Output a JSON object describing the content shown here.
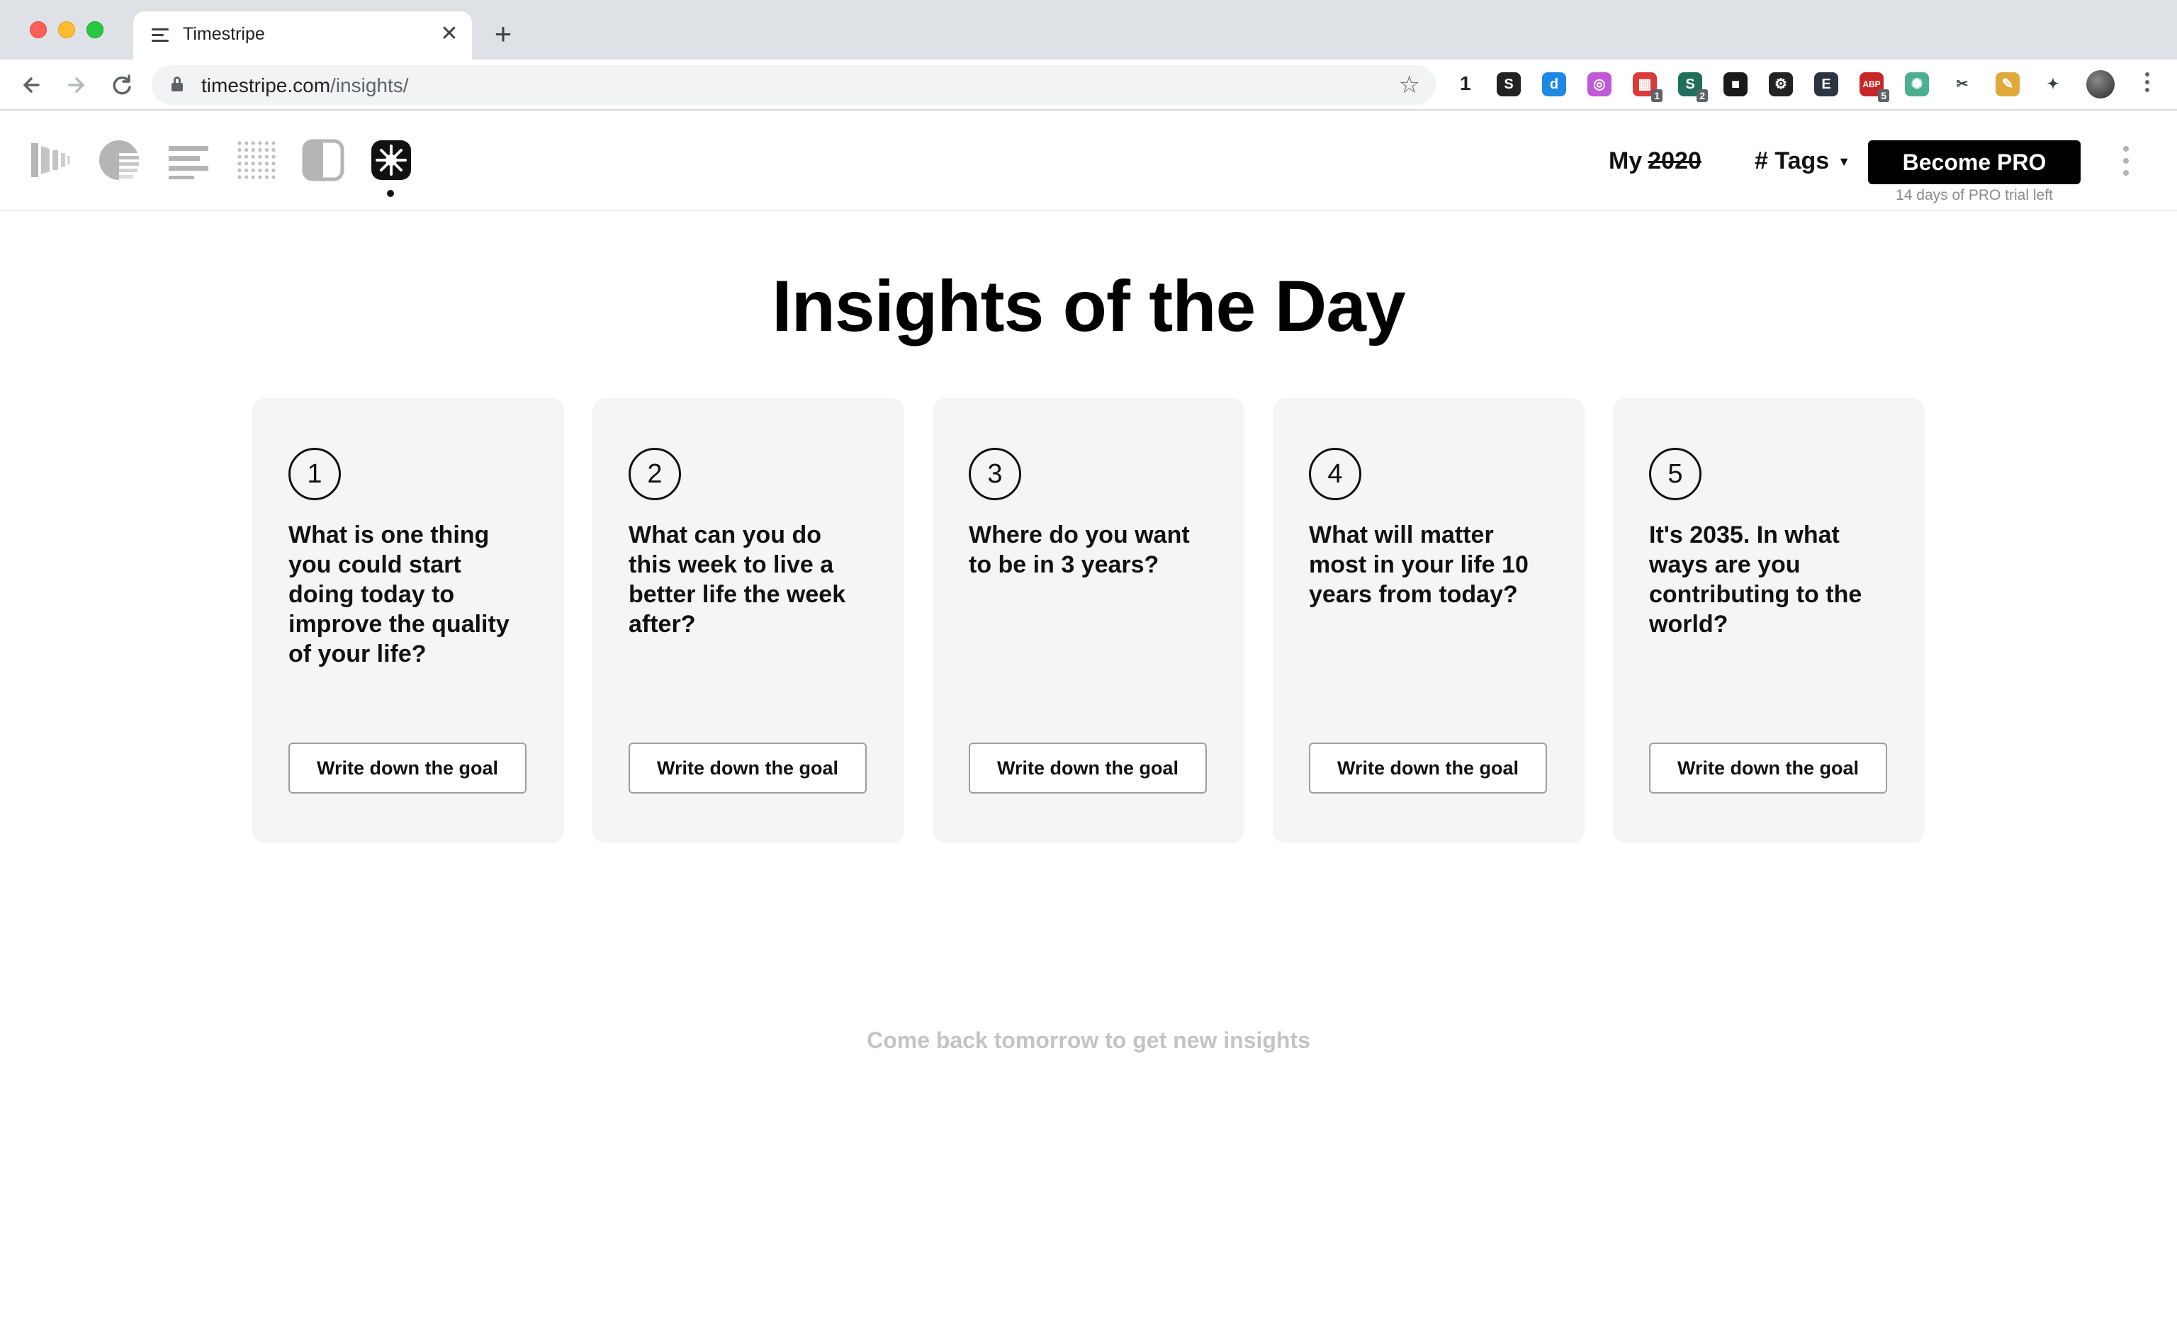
{
  "browser": {
    "tab_title": "Timestripe",
    "tab_close": "✕",
    "new_tab": "+",
    "url_host": "timestripe.com",
    "url_path": "/insights/",
    "extension_count_label": "1",
    "extensions": [
      {
        "name": "extension-s-icon",
        "color": "#222222",
        "glyph": "S",
        "badge": ""
      },
      {
        "name": "extension-d-icon",
        "color": "#1e88e5",
        "glyph": "d",
        "badge": ""
      },
      {
        "name": "extension-target-icon",
        "color": "#c058d8",
        "glyph": "◎",
        "badge": ""
      },
      {
        "name": "extension-calendar-icon",
        "color": "#d93a3a",
        "glyph": "▦",
        "badge": "1"
      },
      {
        "name": "extension-s2-icon",
        "color": "#1e6f5c",
        "glyph": "S",
        "badge": "2"
      },
      {
        "name": "extension-film-icon",
        "color": "#1a1a1a",
        "glyph": "■",
        "badge": ""
      },
      {
        "name": "extension-wheel-icon",
        "color": "#222222",
        "glyph": "⚙",
        "badge": ""
      },
      {
        "name": "extension-e-icon",
        "color": "#2b3542",
        "glyph": "E",
        "badge": ""
      },
      {
        "name": "extension-abp-icon",
        "color": "#c62828",
        "glyph": "ABP",
        "badge": "5"
      },
      {
        "name": "extension-openai-icon",
        "color": "#4caf8f",
        "glyph": "✺",
        "badge": ""
      },
      {
        "name": "extension-scissors-icon",
        "color": "#ffffff",
        "glyph": "✂",
        "badge": ""
      },
      {
        "name": "extension-pencil-icon",
        "color": "#e0a93a",
        "glyph": "✎",
        "badge": ""
      },
      {
        "name": "extensions-puzzle-icon",
        "color": "#ffffff",
        "glyph": "✦",
        "badge": ""
      }
    ]
  },
  "header": {
    "my_label": "My",
    "my_year": "2020",
    "tags_label": "# Tags",
    "tags_caret": "▼",
    "pro_button": "Become PRO",
    "trial_text": "14 days of PRO trial left"
  },
  "main": {
    "title": "Insights of the Day",
    "cards": [
      {
        "number": "1",
        "question": "What is one thing you could start doing today to improve the quality of your life?",
        "button": "Write down the goal"
      },
      {
        "number": "2",
        "question": "What can you do this week to live a better life the week after?",
        "button": "Write down the goal"
      },
      {
        "number": "3",
        "question": "Where do you want to be in 3 years?",
        "button": "Write down the goal"
      },
      {
        "number": "4",
        "question": "What will matter most in your life 10 years from today?",
        "button": "Write down the goal"
      },
      {
        "number": "5",
        "question": "It's 2035. In what ways are you contributing to the world?",
        "button": "Write down the goal"
      }
    ],
    "footer_note": "Come back tomorrow to get new insights"
  }
}
